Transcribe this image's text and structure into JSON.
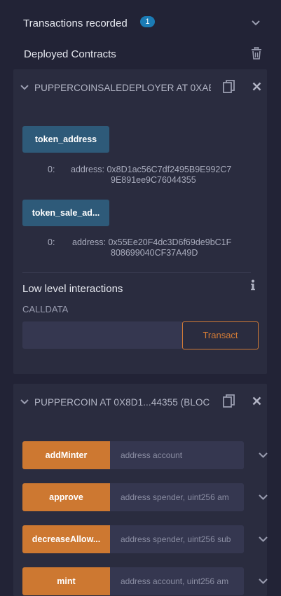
{
  "transactions": {
    "label": "Transactions recorded",
    "count": "1"
  },
  "deployed": {
    "label": "Deployed Contracts"
  },
  "contracts": [
    {
      "title": "PUPPERCOINSALEDEPLOYER AT 0XAB",
      "outputs": [
        {
          "button": "token_address",
          "index": "0:",
          "type": "address:",
          "line1": "0x8D1ac56C7df2495B9E992C7",
          "line2": "9E891ee9C76044355"
        },
        {
          "button": "token_sale_ad...",
          "index": "0:",
          "type": "address:",
          "line1": "0x55Ee20F4dc3D6f69de9bC1F",
          "line2": "808699040CF37A49D"
        }
      ],
      "low_level": {
        "title": "Low level interactions",
        "calldata_label": "CALLDATA",
        "transact_label": "Transact"
      }
    },
    {
      "title": "PUPPERCOIN AT 0X8D1...44355 (BLOC",
      "functions": [
        {
          "name": "addMinter",
          "placeholder": "address account"
        },
        {
          "name": "approve",
          "placeholder": "address spender, uint256 am"
        },
        {
          "name": "decreaseAllow...",
          "placeholder": "address spender, uint256 sub"
        },
        {
          "name": "mint",
          "placeholder": "address account, uint256 am"
        }
      ]
    }
  ],
  "colors": {
    "background": "#222336",
    "panel": "#2a2c3f",
    "call_button": "#2e5a79",
    "transact_button": "#cd7831",
    "badge": "#1b7bb5"
  }
}
